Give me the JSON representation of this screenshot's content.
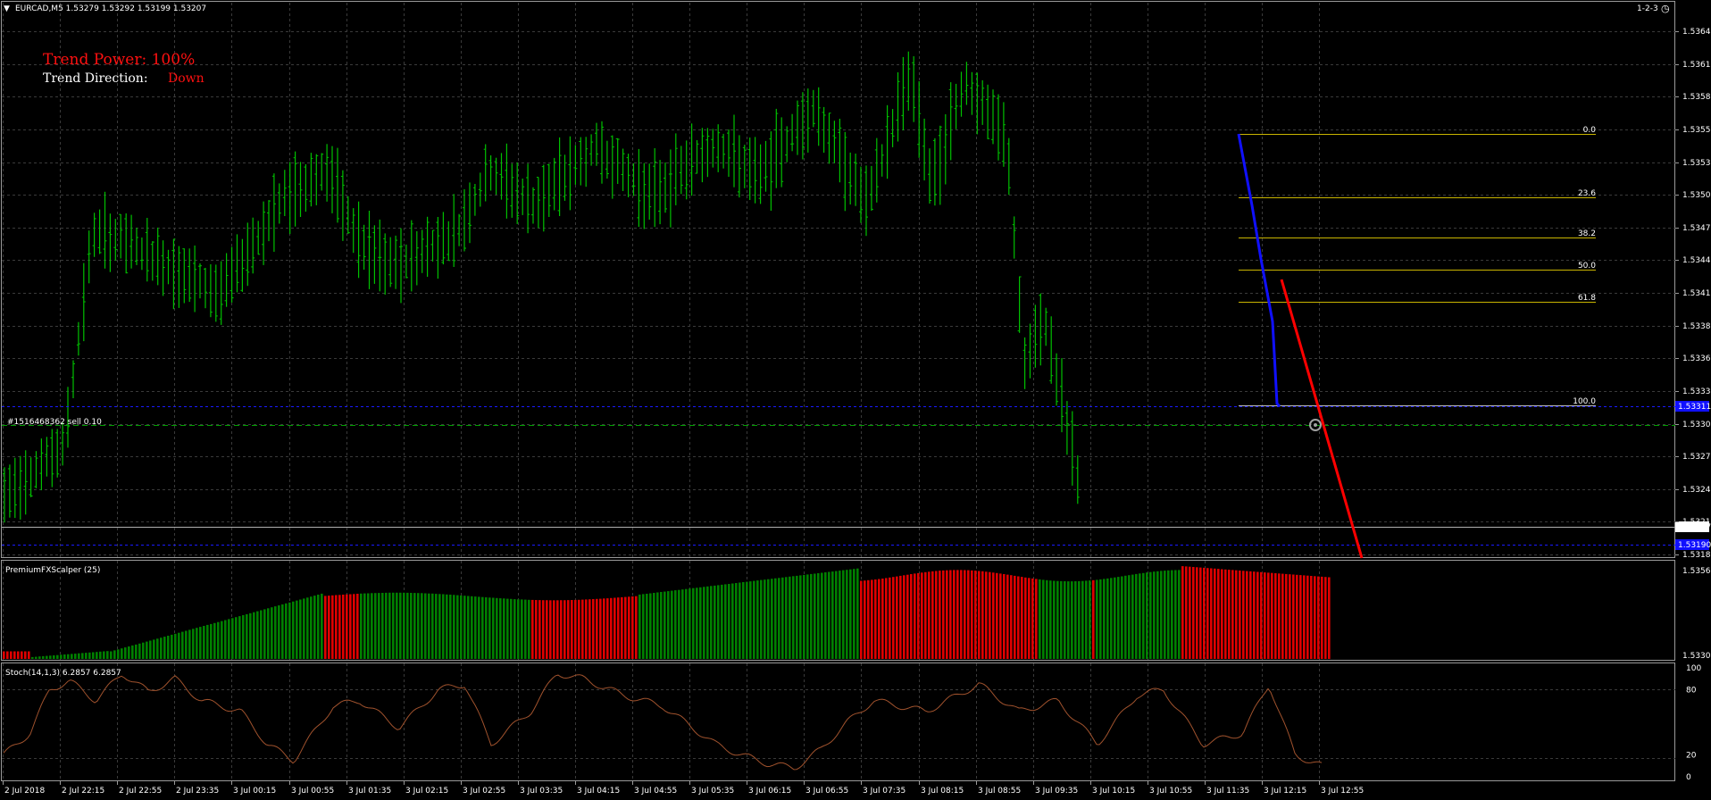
{
  "header": {
    "symbol_info": "EURCAD,M5  1.53279 1.53292 1.53199 1.53207",
    "right_label": "1-2-3"
  },
  "overlay": {
    "trend_power": "Trend Power: 100%",
    "trend_direction_label": "Trend Direction:",
    "trend_direction_value": "Down",
    "order_label": "#1516468362 sell 0.10"
  },
  "colors": {
    "background": "#000000",
    "grid": "#3a3a3a",
    "candle_up": "#00c000",
    "bar_green": "#008000",
    "bar_red": "#e00000",
    "fib": "#c8b400",
    "blue_line": "#1010ff",
    "red_line": "#ff0000",
    "stoch": "#a0522d"
  },
  "main_axis": {
    "ticks": [
      "1.53640",
      "1.53610",
      "1.53585",
      "1.53555",
      "1.53530",
      "1.53500",
      "1.53470",
      "1.53445",
      "1.53415",
      "1.53385",
      "1.53360",
      "1.53330",
      "1.53300",
      "1.53275",
      "1.53245",
      "1.53215",
      "1.53185"
    ],
    "current_price": "1.53207",
    "blue_tag_upper": "1.53311",
    "blue_tag_lower": "1.53190"
  },
  "fib_levels": [
    "0.0",
    "23.6",
    "38.2",
    "50.0",
    "61.8",
    "100.0"
  ],
  "scalper": {
    "title": "PremiumFXScalper (25)",
    "axis_top": "1.53561",
    "axis_bottom": "1.53301"
  },
  "stoch": {
    "title": "Stoch(14,1,3) 6.2857 6.2857",
    "ticks": [
      "100",
      "80",
      "20",
      "0"
    ]
  },
  "time_axis": [
    "2 Jul 2018",
    "2 Jul 22:15",
    "2 Jul 22:55",
    "2 Jul 23:35",
    "3 Jul 00:15",
    "3 Jul 00:55",
    "3 Jul 01:35",
    "3 Jul 02:15",
    "3 Jul 02:55",
    "3 Jul 03:35",
    "3 Jul 04:15",
    "3 Jul 04:55",
    "3 Jul 05:35",
    "3 Jul 06:15",
    "3 Jul 06:55",
    "3 Jul 07:35",
    "3 Jul 08:15",
    "3 Jul 08:55",
    "3 Jul 09:35",
    "3 Jul 10:15",
    "3 Jul 10:55",
    "3 Jul 11:35",
    "3 Jul 12:15",
    "3 Jul 12:55"
  ]
}
